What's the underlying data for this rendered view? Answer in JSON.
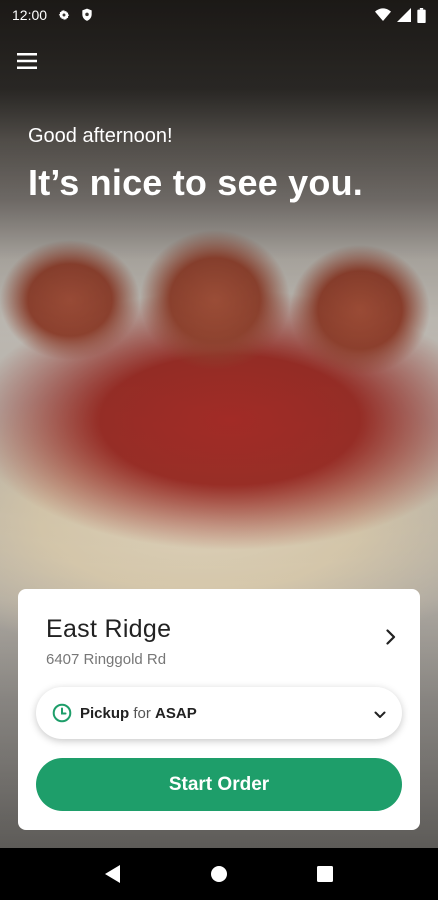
{
  "status_bar": {
    "time": "12:00",
    "icons": [
      "settings-icon",
      "shield-icon",
      "wifi-icon",
      "signal-icon",
      "battery-icon"
    ]
  },
  "header": {
    "menu_icon": "menu-icon"
  },
  "hero": {
    "greeting": "Good afternoon!",
    "tagline": "It’s nice to see you."
  },
  "location_card": {
    "name": "East Ridge",
    "address": "6407 Ringgold Rd",
    "pickup": {
      "mode": "Pickup",
      "connector": "for",
      "time": "ASAP",
      "icon": "clock-icon"
    },
    "start_order_label": "Start Order"
  },
  "nav_bar": {
    "icons": [
      "back-icon",
      "home-icon",
      "recents-icon"
    ]
  },
  "colors": {
    "accent": "#1e9e6a",
    "card_bg": "#ffffff",
    "text_primary": "#222222",
    "text_secondary": "#777777"
  }
}
